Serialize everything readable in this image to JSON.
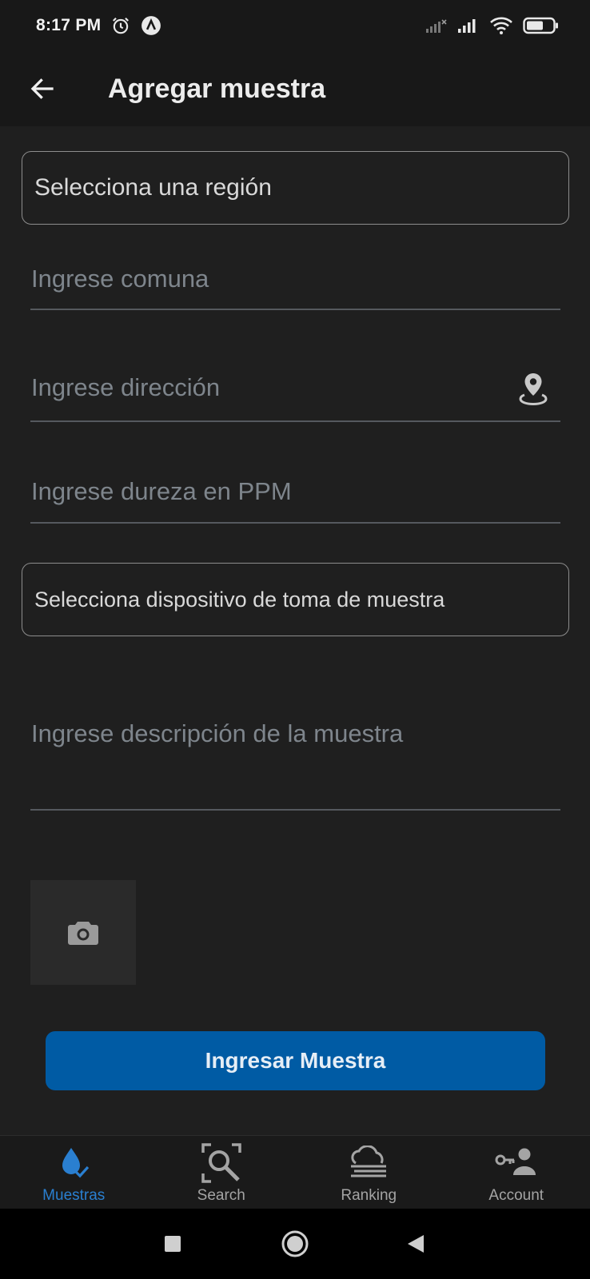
{
  "status_bar": {
    "time": "8:17 PM",
    "icons": [
      "alarm-icon",
      "app-notification-icon",
      "signal-none-icon",
      "signal-icon",
      "wifi-icon",
      "battery-icon"
    ]
  },
  "app_bar": {
    "title": "Agregar muestra",
    "back_icon": "arrow-left-icon"
  },
  "form": {
    "region_select": {
      "placeholder": "Selecciona una región"
    },
    "comuna_field": {
      "placeholder": "Ingrese comuna"
    },
    "direccion_field": {
      "placeholder": "Ingrese dirección",
      "icon": "location-pin-icon"
    },
    "dureza_field": {
      "placeholder": "Ingrese dureza en PPM"
    },
    "device_select": {
      "placeholder": "Selecciona dispositivo de toma de muestra"
    },
    "descripcion_field": {
      "placeholder": "Ingrese descripción de la muestra"
    },
    "photo_button": {
      "icon": "camera-icon"
    },
    "submit_label": "Ingresar Muestra"
  },
  "bottom_nav": {
    "items": [
      {
        "label": "Muestras",
        "icon": "water-drop-check-icon",
        "active": true
      },
      {
        "label": "Search",
        "icon": "search-scan-icon",
        "active": false
      },
      {
        "label": "Ranking",
        "icon": "cloud-fog-icon",
        "active": false
      },
      {
        "label": "Account",
        "icon": "key-user-icon",
        "active": false
      }
    ]
  },
  "system_nav": {
    "buttons": [
      "recents-square-icon",
      "home-circle-icon",
      "back-triangle-icon"
    ]
  },
  "colors": {
    "background": "#1f1f1f",
    "bar_background": "#181818",
    "accent": "#005ba4",
    "active_nav": "#2a7fd0",
    "placeholder": "#7e858c"
  }
}
